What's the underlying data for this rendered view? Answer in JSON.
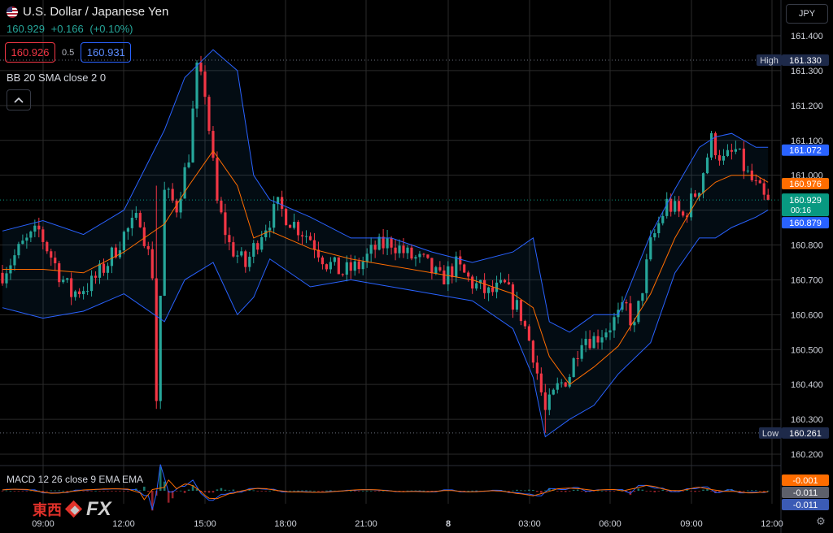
{
  "header": {
    "title": "U.S. Dollar / Japanese Yen",
    "last": "160.929",
    "change": "+0.166",
    "change_pct": "(+0.10%)",
    "bid": "160.926",
    "spread": "0.5",
    "ask": "160.931",
    "bb_label": "BB 20 SMA close 2 0",
    "macd_label": "MACD 12 26 close 9 EMA EMA",
    "currency_button": "JPY",
    "collapse_icon": "chevron-up-icon",
    "settings_icon": "gear-icon"
  },
  "watermark": {
    "text_cn": "東西",
    "text_fx": "FX"
  },
  "colors": {
    "up": "#26a69a",
    "down": "#f23645",
    "bb_band": "#2962ff",
    "bb_basis": "#ff6d00",
    "grid": "#2a2a2a",
    "high_low": "#1e2a4a"
  },
  "chart_data": {
    "type": "candlestick",
    "symbol": "USDJPY",
    "ylim": [
      160.2,
      161.44
    ],
    "yticks": [
      "161.400",
      "161.300",
      "161.200",
      "161.100",
      "161.000",
      "160.900",
      "160.800",
      "160.700",
      "160.600",
      "160.500",
      "160.400",
      "160.300",
      "160.200"
    ],
    "xticks": [
      "09:00",
      "12:00",
      "15:00",
      "18:00",
      "21:00",
      "8",
      "03:00",
      "06:00",
      "09:00",
      "12:00"
    ],
    "close_path": [
      [
        0,
        160.72
      ],
      [
        5,
        160.8
      ],
      [
        9,
        160.84
      ],
      [
        14,
        160.72
      ],
      [
        17,
        160.66
      ],
      [
        22,
        160.69
      ],
      [
        26,
        160.75
      ],
      [
        30,
        160.83
      ],
      [
        34,
        160.88
      ],
      [
        37,
        160.72
      ],
      [
        38,
        160.36
      ],
      [
        40,
        160.95
      ],
      [
        43,
        160.91
      ],
      [
        46,
        161.06
      ],
      [
        48,
        161.3
      ],
      [
        50,
        161.24
      ],
      [
        53,
        160.92
      ],
      [
        56,
        160.8
      ],
      [
        60,
        160.74
      ],
      [
        64,
        160.84
      ],
      [
        68,
        160.91
      ],
      [
        72,
        160.86
      ],
      [
        76,
        160.82
      ],
      [
        80,
        160.75
      ],
      [
        84,
        160.72
      ],
      [
        88,
        160.74
      ],
      [
        92,
        160.79
      ],
      [
        96,
        160.81
      ],
      [
        100,
        160.77
      ],
      [
        104,
        160.75
      ],
      [
        108,
        160.7
      ],
      [
        112,
        160.74
      ],
      [
        116,
        160.69
      ],
      [
        120,
        160.66
      ],
      [
        124,
        160.68
      ],
      [
        128,
        160.6
      ],
      [
        131,
        160.49
      ],
      [
        134,
        160.32
      ],
      [
        137,
        160.39
      ],
      [
        140,
        160.43
      ],
      [
        143,
        160.54
      ],
      [
        146,
        160.53
      ],
      [
        150,
        160.57
      ],
      [
        154,
        160.62
      ],
      [
        156,
        160.56
      ],
      [
        160,
        160.8
      ],
      [
        164,
        160.92
      ],
      [
        168,
        160.88
      ],
      [
        172,
        160.97
      ],
      [
        175,
        161.1
      ],
      [
        178,
        161.04
      ],
      [
        181,
        161.07
      ],
      [
        184,
        161.0
      ],
      [
        187,
        160.95
      ],
      [
        189,
        160.91
      ]
    ],
    "bb": {
      "upper_path": [
        [
          0,
          160.84
        ],
        [
          10,
          160.87
        ],
        [
          20,
          160.83
        ],
        [
          30,
          160.9
        ],
        [
          40,
          161.13
        ],
        [
          45,
          161.28
        ],
        [
          52,
          161.36
        ],
        [
          58,
          161.3
        ],
        [
          62,
          161.0
        ],
        [
          66,
          160.93
        ],
        [
          76,
          160.88
        ],
        [
          86,
          160.82
        ],
        [
          96,
          160.82
        ],
        [
          106,
          160.78
        ],
        [
          116,
          160.75
        ],
        [
          126,
          160.78
        ],
        [
          131,
          160.82
        ],
        [
          135,
          160.58
        ],
        [
          140,
          160.55
        ],
        [
          146,
          160.6
        ],
        [
          152,
          160.6
        ],
        [
          160,
          160.83
        ],
        [
          166,
          160.96
        ],
        [
          172,
          161.08
        ],
        [
          176,
          161.11
        ],
        [
          180,
          161.12
        ],
        [
          186,
          161.08
        ],
        [
          189,
          161.08
        ]
      ],
      "lower_path": [
        [
          0,
          160.62
        ],
        [
          10,
          160.59
        ],
        [
          20,
          160.61
        ],
        [
          30,
          160.66
        ],
        [
          40,
          160.58
        ],
        [
          45,
          160.7
        ],
        [
          52,
          160.75
        ],
        [
          58,
          160.6
        ],
        [
          62,
          160.65
        ],
        [
          66,
          160.76
        ],
        [
          76,
          160.68
        ],
        [
          86,
          160.7
        ],
        [
          96,
          160.68
        ],
        [
          106,
          160.66
        ],
        [
          116,
          160.64
        ],
        [
          126,
          160.56
        ],
        [
          131,
          160.42
        ],
        [
          134,
          160.25
        ],
        [
          140,
          160.3
        ],
        [
          146,
          160.34
        ],
        [
          152,
          160.43
        ],
        [
          160,
          160.52
        ],
        [
          166,
          160.72
        ],
        [
          172,
          160.82
        ],
        [
          176,
          160.82
        ],
        [
          180,
          160.85
        ],
        [
          186,
          160.88
        ],
        [
          189,
          160.9
        ]
      ],
      "basis_path": [
        [
          0,
          160.73
        ],
        [
          10,
          160.73
        ],
        [
          20,
          160.72
        ],
        [
          30,
          160.78
        ],
        [
          40,
          160.86
        ],
        [
          46,
          160.97
        ],
        [
          52,
          161.07
        ],
        [
          58,
          160.97
        ],
        [
          62,
          160.82
        ],
        [
          66,
          160.84
        ],
        [
          76,
          160.79
        ],
        [
          86,
          160.76
        ],
        [
          96,
          160.74
        ],
        [
          106,
          160.72
        ],
        [
          116,
          160.7
        ],
        [
          126,
          160.66
        ],
        [
          131,
          160.62
        ],
        [
          135,
          160.48
        ],
        [
          140,
          160.4
        ],
        [
          146,
          160.45
        ],
        [
          152,
          160.51
        ],
        [
          160,
          160.66
        ],
        [
          166,
          160.82
        ],
        [
          172,
          160.94
        ],
        [
          176,
          160.98
        ],
        [
          180,
          161.0
        ],
        [
          186,
          161.0
        ],
        [
          189,
          160.98
        ]
      ]
    },
    "high": {
      "label": "High",
      "value": "161.330"
    },
    "low": {
      "label": "Low",
      "value": "160.261"
    },
    "price_labels": [
      {
        "value": "161.072",
        "color": "#2962ff"
      },
      {
        "value": "160.976",
        "color": "#ff6d00"
      },
      {
        "value": "160.929",
        "color": "#089981",
        "countdown": "00:16"
      },
      {
        "value": "160.879",
        "color": "#2962ff"
      }
    ],
    "macd": {
      "labels": [
        {
          "value": "-0.001",
          "color": "#ff6d00"
        },
        {
          "value": "-0.011",
          "color": "#9598a1"
        },
        {
          "value": "-0.011",
          "color": "#2962ff"
        }
      ]
    }
  }
}
